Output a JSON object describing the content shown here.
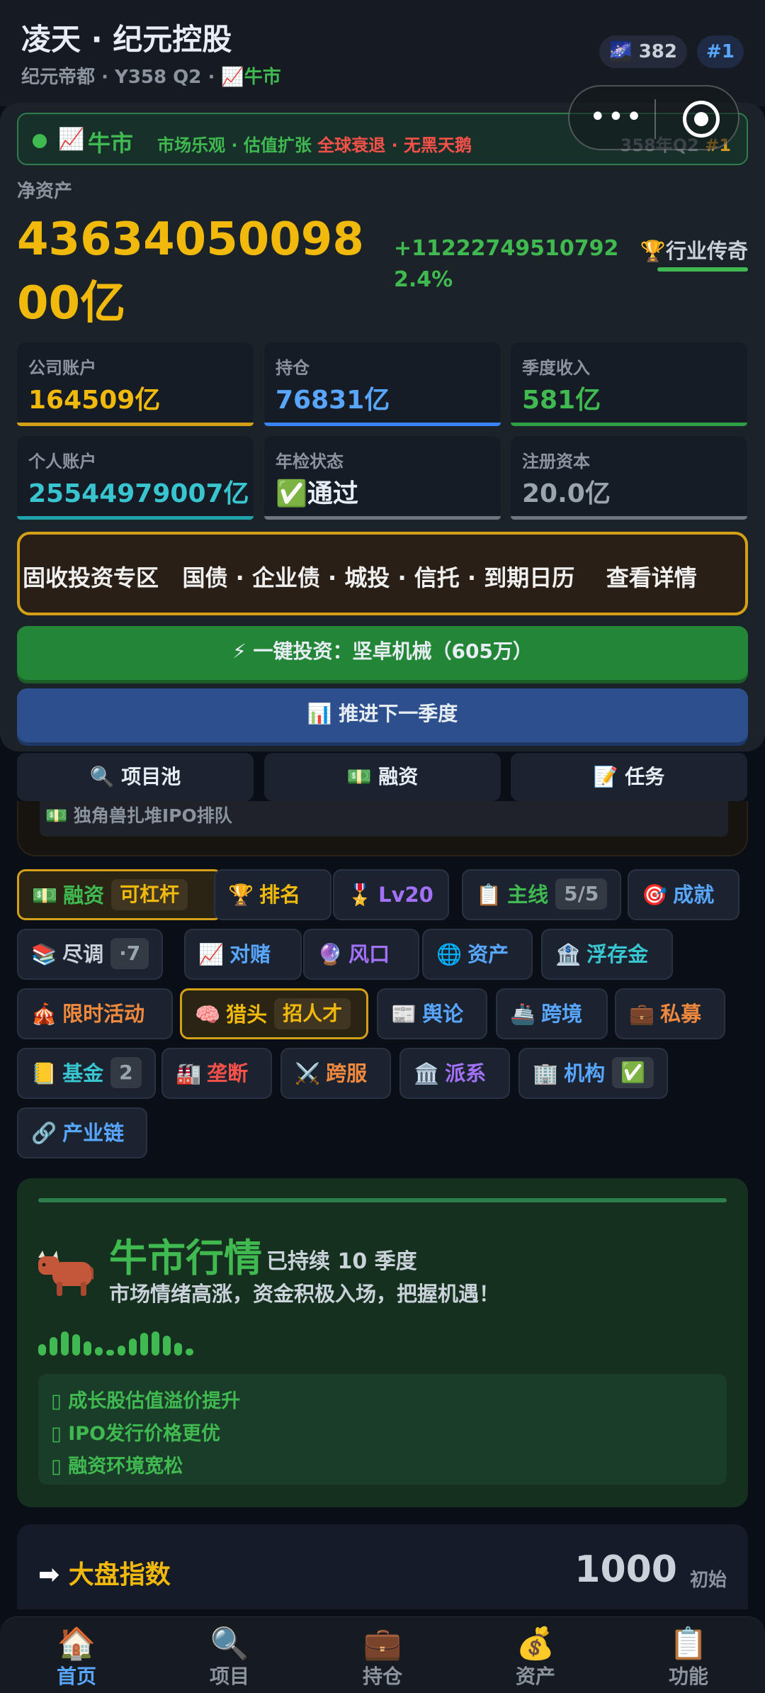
{
  "header": {
    "title": "凌天 · 纪元控股",
    "era": "纪元帝都",
    "period": "Y358 Q2",
    "market_icon": "📈",
    "market": "牛市",
    "stars": "382",
    "stars_icon": "🌌",
    "rank": "#1"
  },
  "market_bar": {
    "icon": "📈",
    "label": "牛市",
    "tag1": "市场乐观",
    "tag2": "估值扩张",
    "tag3": "全球衰退",
    "tag4": "无黑天鹅",
    "period": "358年Q2",
    "rank": "#1"
  },
  "net_worth": {
    "label": "净资产",
    "value": "4363405009800亿",
    "change": "+11222749510792",
    "change_pct": "2.4%",
    "rank_icon": "🏆",
    "rank_label": "行业传奇"
  },
  "stats": [
    {
      "label": "公司账户",
      "value": "164509亿",
      "color": "#f0b90b",
      "line": "#d4a017"
    },
    {
      "label": "持仓",
      "value": "76831亿",
      "color": "#58a6ff",
      "line": "#3b82f6"
    },
    {
      "label": "季度收入",
      "value": "581亿",
      "color": "#3fb950",
      "line": "#2ea043"
    },
    {
      "label": "个人账户",
      "value": "25544979007亿",
      "color": "#39c5cf",
      "line": "#1fa3ad"
    },
    {
      "label": "年检状态",
      "value": "✅通过",
      "color": "#e6edf3",
      "line": "#6e7681"
    },
    {
      "label": "注册资本",
      "value": "20.0亿",
      "color": "#9aa4ad",
      "line": "#6e7681"
    }
  ],
  "fixed_income": {
    "title": "固收投资专区",
    "items": "国债 · 企业债 · 城投 · 信托 · 到期日历",
    "link": "查看详情"
  },
  "actions": {
    "invest": "⚡ 一键投资：坚卓机械（605万）",
    "next_quarter": "📊 推进下一季度"
  },
  "tabs": [
    {
      "icon": "🔍",
      "label": "项目池"
    },
    {
      "icon": "💵",
      "label": "融资"
    },
    {
      "icon": "📝",
      "label": "任务"
    }
  ],
  "ipo_note": "💵 独角兽扎堆IPO排队",
  "chips": [
    {
      "icon": "💵",
      "label": "融资",
      "badge": "可杠杆",
      "color": "#3fb950"
    },
    {
      "icon": "🏆",
      "label": "排名",
      "badge": "",
      "color": "#f0b90b"
    },
    {
      "icon": "🎖️",
      "label": "Lv20",
      "badge": "",
      "color": "#a371f7"
    },
    {
      "icon": "📋",
      "label": "主线",
      "badge": "5/5",
      "color": "#3fb950"
    },
    {
      "icon": "🎯",
      "label": "成就",
      "badge": "",
      "color": "#58a6ff"
    },
    {
      "icon": "📚",
      "label": "尽调",
      "badge": "·7",
      "color": "#c9d1d9"
    },
    {
      "icon": "📈",
      "label": "对赌",
      "badge": "",
      "color": "#58a6ff"
    },
    {
      "icon": "🔮",
      "label": "风口",
      "badge": "",
      "color": "#a371f7"
    },
    {
      "icon": "🌐",
      "label": "资产",
      "badge": "",
      "color": "#58a6ff"
    },
    {
      "icon": "🏦",
      "label": "浮存金",
      "badge": "",
      "color": "#39c5cf"
    },
    {
      "icon": "🎪",
      "label": "限时活动",
      "badge": "",
      "color": "#f0883e"
    },
    {
      "icon": "🧠",
      "label": "猎头",
      "badge": "招人才",
      "color": "#f0b90b"
    },
    {
      "icon": "📰",
      "label": "舆论",
      "badge": "",
      "color": "#58a6ff"
    },
    {
      "icon": "🚢",
      "label": "跨境",
      "badge": "",
      "color": "#58a6ff"
    },
    {
      "icon": "💼",
      "label": "私募",
      "badge": "",
      "color": "#f0883e"
    },
    {
      "icon": "📒",
      "label": "基金",
      "badge": "2",
      "color": "#39c5cf"
    },
    {
      "icon": "🏭",
      "label": "垄断",
      "badge": "",
      "color": "#f85149"
    },
    {
      "icon": "⚔️",
      "label": "跨服",
      "badge": "",
      "color": "#f0883e"
    },
    {
      "icon": "🏛️",
      "label": "派系",
      "badge": "",
      "color": "#a371f7"
    },
    {
      "icon": "🏢",
      "label": "机构",
      "badge": "✅",
      "color": "#58a6ff"
    },
    {
      "icon": "🔗",
      "label": "产业链",
      "badge": "",
      "color": "#58a6ff"
    }
  ],
  "bull_card": {
    "title": "牛市行情",
    "duration": "已持续 10 季度",
    "desc": "市场情绪高涨，资金积极入场，把握机遇！",
    "effects": [
      "成长股估值溢价提升",
      "IPO发行价格更优",
      "融资环境宽松"
    ]
  },
  "index_card": {
    "icon": "➡",
    "title": "大盘指数",
    "value": "1000",
    "sub": "初始"
  },
  "bottom_nav": [
    {
      "icon": "🏠",
      "label": "首页",
      "active": true
    },
    {
      "icon": "🔍",
      "label": "项目",
      "active": false
    },
    {
      "icon": "💼",
      "label": "持仓",
      "active": false
    },
    {
      "icon": "💰",
      "label": "资产",
      "active": false
    },
    {
      "icon": "📋",
      "label": "功能",
      "active": false
    }
  ]
}
